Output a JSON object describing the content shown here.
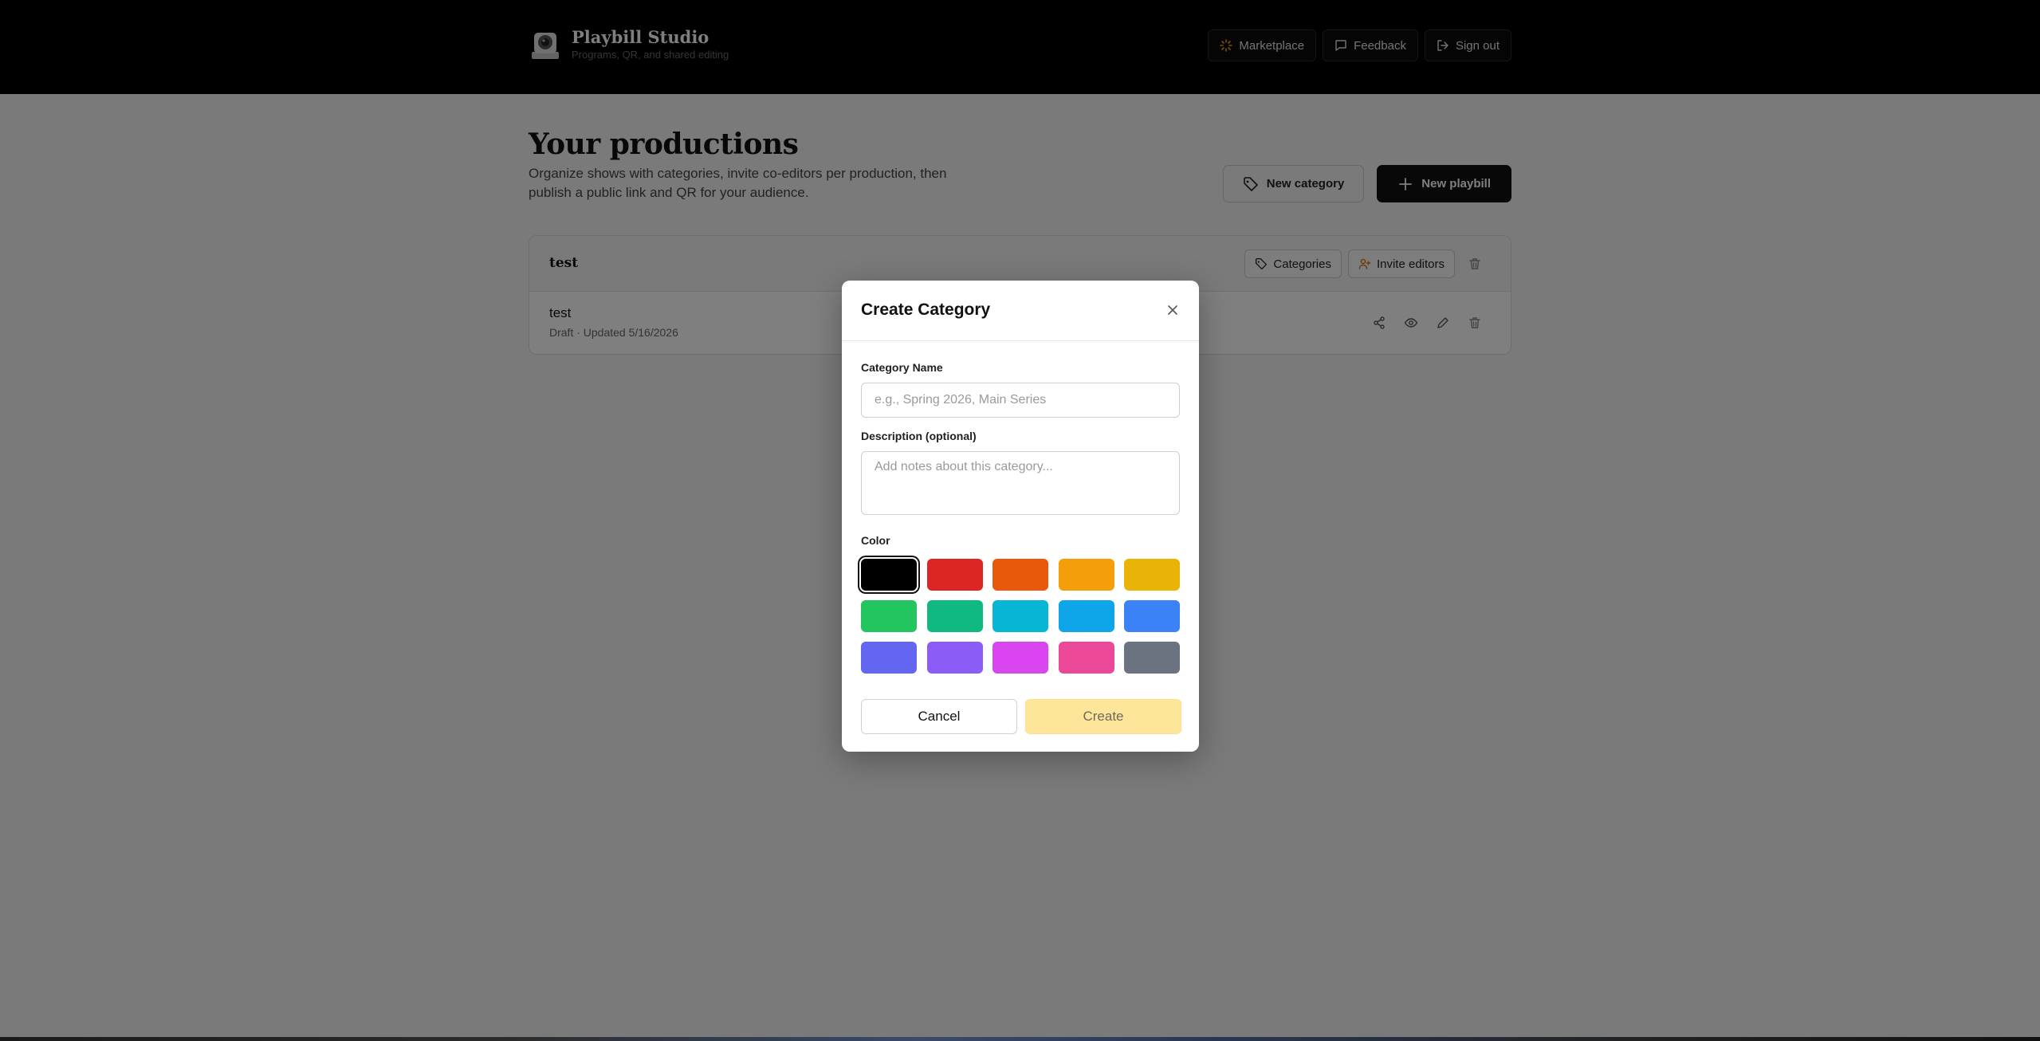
{
  "app": {
    "name": "Playbill Studio",
    "tagline": "Programs, QR, and shared editing"
  },
  "header": {
    "buttons": [
      {
        "label": "Marketplace",
        "icon": "sparkle-icon"
      },
      {
        "label": "Feedback",
        "icon": "message-icon"
      },
      {
        "label": "Sign out",
        "icon": "sign-out-icon"
      }
    ]
  },
  "main": {
    "title": "Your productions",
    "description": "Organize shows with categories, invite co-editors per production, then publish a public link and QR for your audience.",
    "new_category_label": "New category",
    "new_playbill_label": "New playbill",
    "categories": [
      {
        "name": "test",
        "categories_label": "Categories",
        "invite_label": "Invite editors",
        "productions": [
          {
            "title": "test",
            "meta": "Draft · Updated 5/16/2026"
          }
        ]
      }
    ]
  },
  "modal": {
    "title": "Create Category",
    "name_label": "Category Name",
    "name_placeholder": "e.g., Spring 2026, Main Series",
    "name_value": "",
    "description_label": "Description (optional)",
    "description_placeholder": "Add notes about this category...",
    "color_label": "Color",
    "colors": [
      "#000000",
      "#dc2626",
      "#ea580c",
      "#f59e0b",
      "#eab308",
      "#22c55e",
      "#10b981",
      "#06b6d4",
      "#0ea5e9",
      "#3b82f6",
      "#6366f1",
      "#8b5cf6",
      "#d946ef",
      "#ec4899",
      "#6b7280"
    ],
    "selected_color": "#000000",
    "cancel_label": "Cancel",
    "create_label": "Create"
  }
}
